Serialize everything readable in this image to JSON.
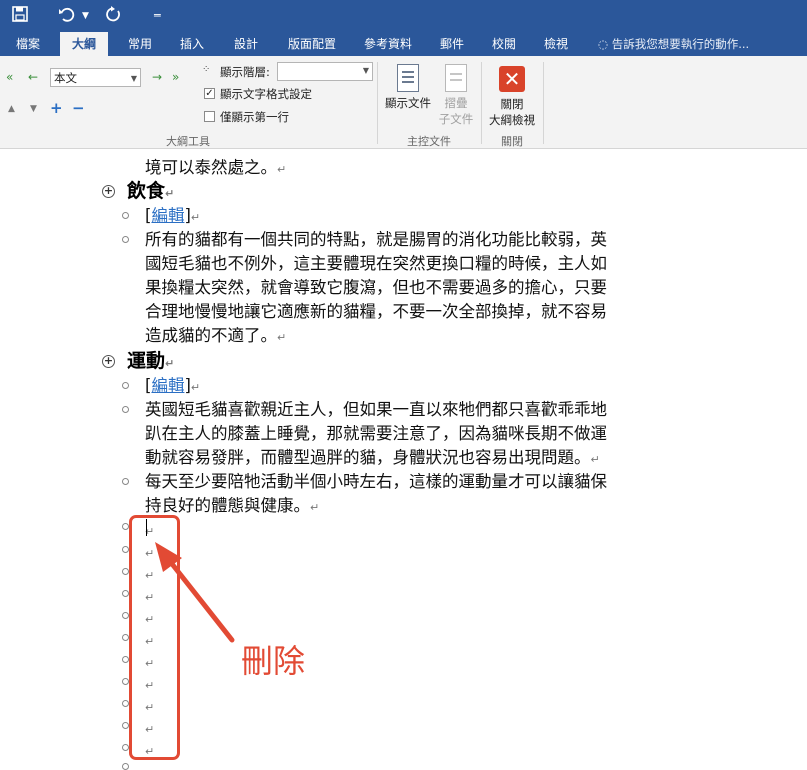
{
  "quick_access": {
    "save_icon": "save-icon",
    "undo_icon": "undo-icon",
    "redo_icon": "redo-icon",
    "customize_icon": "customize-icon"
  },
  "tabs": [
    {
      "label": "檔案"
    },
    {
      "label": "大綱"
    },
    {
      "label": "常用"
    },
    {
      "label": "插入"
    },
    {
      "label": "設計"
    },
    {
      "label": "版面配置"
    },
    {
      "label": "參考資料"
    },
    {
      "label": "郵件"
    },
    {
      "label": "校閱"
    },
    {
      "label": "檢視"
    }
  ],
  "tell_me": "告訴我您想要執行的動作...",
  "ribbon": {
    "outline_tools": {
      "level_value": "本文",
      "show_level_label": "顯示階層:",
      "show_text_format_label": "顯示文字格式設定",
      "show_text_format_checked": true,
      "show_first_line_label": "僅顯示第一行",
      "show_first_line_checked": false,
      "group_label": "大綱工具"
    },
    "master_document": {
      "show_document_label": "顯示文件",
      "collapse_subdocs_line1": "摺疊",
      "collapse_subdocs_line2": "子文件",
      "group_label": "主控文件"
    },
    "close": {
      "close_label_line1": "關閉",
      "close_label_line2": "大綱檢視",
      "group_label": "關閉"
    }
  },
  "document": {
    "line0": "境可以泰然處之。",
    "heading1": "飲食",
    "edit_link": "編輯",
    "para1_lines": [
      "所有的貓都有一個共同的特點，就是腸胃的消化功能比較弱，英",
      "國短毛貓也不例外，這主要體現在突然更換口糧的時候，主人如",
      "果換糧太突然，就會導致它腹瀉，但也不需要過多的擔心，只要",
      "合理地慢慢地讓它適應新的貓糧，不要一次全部換掉，就不容易",
      "造成貓的不適了。"
    ],
    "heading2": "運動",
    "para2_lines": [
      "英國短毛貓喜歡親近主人，但如果一直以來牠們都只喜歡乖乖地",
      "趴在主人的膝蓋上睡覺，那就需要注意了，因為貓咪長期不做運",
      "動就容易發胖，而體型過胖的貓，身體狀況也容易出現問題。"
    ],
    "para3_lines": [
      "每天至少要陪牠活動半個小時左右，這樣的運動量才可以讓貓保",
      "持良好的體態與健康。"
    ],
    "paragraph_mark": "↵"
  },
  "annotation": {
    "label": "刪除",
    "color": "#e24a34"
  },
  "colors": {
    "brand": "#2b579a",
    "link": "#2b6fc4"
  }
}
